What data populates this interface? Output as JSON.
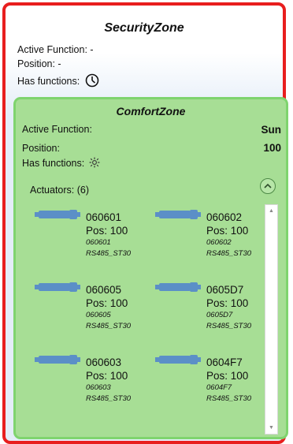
{
  "security_zone": {
    "title": "SecurityZone",
    "active_function_label": "Active Function: -",
    "position_label": "Position: -",
    "has_functions_label": "Has functions:",
    "function_icon": "clock-icon"
  },
  "comfort_zone": {
    "title": "ComfortZone",
    "active_function_label": "Active Function:",
    "active_function_value": "Sun",
    "position_label": "Position:",
    "position_value": "100",
    "has_functions_label": "Has functions:",
    "function_icon": "sun-icon",
    "actuators_label": "Actuators: (6)",
    "actuators": [
      {
        "name": "060601",
        "pos": "Pos: 100",
        "id": "060601",
        "type": "RS485_ST30"
      },
      {
        "name": "060602",
        "pos": "Pos: 100",
        "id": "060602",
        "type": "RS485_ST30"
      },
      {
        "name": "060605",
        "pos": "Pos: 100",
        "id": "060605",
        "type": "RS485_ST30"
      },
      {
        "name": "0605D7",
        "pos": "Pos: 100",
        "id": "0605D7",
        "type": "RS485_ST30"
      },
      {
        "name": "060603",
        "pos": "Pos: 100",
        "id": "060603",
        "type": "RS485_ST30"
      },
      {
        "name": "0604F7",
        "pos": "Pos: 100",
        "id": "0604F7",
        "type": "RS485_ST30"
      }
    ]
  },
  "colors": {
    "security_border": "#e81e1e",
    "comfort_bg": "#a7de95",
    "comfort_border": "#7fd46e",
    "actuator_icon": "#5b8fc7"
  }
}
